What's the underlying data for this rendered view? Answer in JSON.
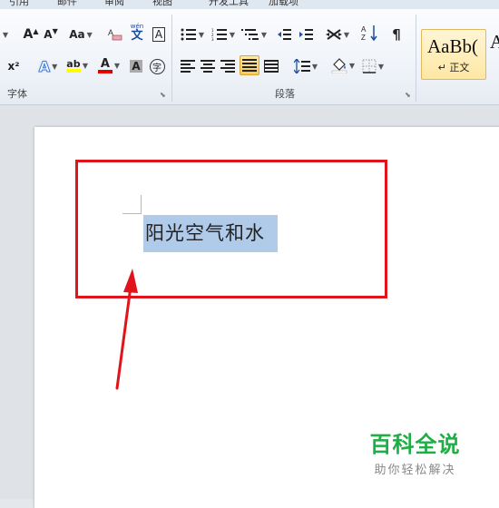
{
  "tabs": [
    "引用",
    "邮件",
    "审阅",
    "视图",
    "开发工具",
    "加载项"
  ],
  "font_group": {
    "label": "字体",
    "grow_font": "A",
    "shrink_font": "A",
    "change_case": "Aa",
    "pinyin_guide": "wén",
    "pinyin_char": "文",
    "char_border": "A",
    "superscript": "x²",
    "text_effect": "A",
    "highlight": "ab",
    "font_color": "A",
    "char_shading": "A",
    "enclose_char": "字"
  },
  "paragraph_group": {
    "label": "段落",
    "sort": "A↓Z",
    "show_marks": "¶"
  },
  "styles": {
    "normal_sample": "AaBb(",
    "normal_name": "↵ 正文",
    "next_sample": "A"
  },
  "document": {
    "selected_text": "阳光空气和水"
  },
  "watermark": {
    "title": "百科全说",
    "subtitle": "助你轻松解决"
  },
  "colors": {
    "annotation_red": "#e0151b",
    "selection_blue": "#b0cbea",
    "watermark_green": "#1fae45"
  }
}
